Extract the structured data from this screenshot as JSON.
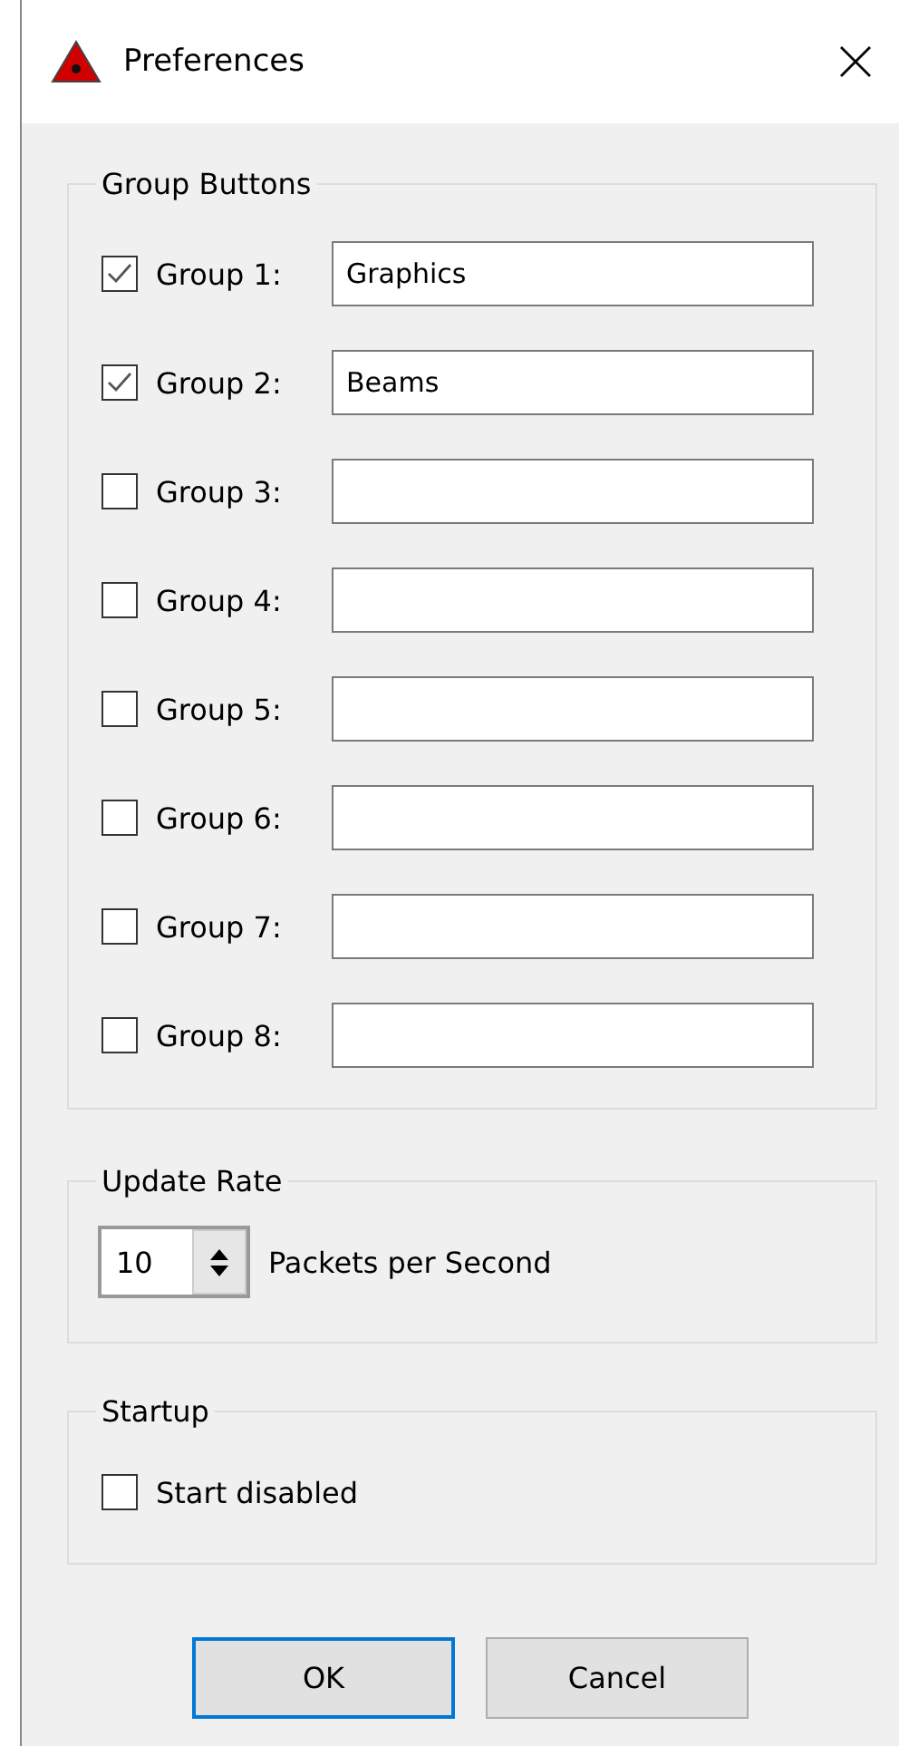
{
  "window": {
    "title": "Preferences"
  },
  "group_buttons": {
    "title": "Group Buttons",
    "groups": [
      {
        "label": "Group 1:",
        "checked": true,
        "value": "Graphics"
      },
      {
        "label": "Group 2:",
        "checked": true,
        "value": "Beams"
      },
      {
        "label": "Group 3:",
        "checked": false
      },
      {
        "label": "Group 4:",
        "checked": false
      },
      {
        "label": "Group 5:",
        "checked": false
      },
      {
        "label": "Group 6:",
        "checked": false
      },
      {
        "label": "Group 7:",
        "checked": false
      },
      {
        "label": "Group 8:",
        "checked": false
      }
    ]
  },
  "update_rate": {
    "title": "Update Rate",
    "value": "10",
    "unit": "Packets per Second"
  },
  "startup": {
    "title": "Startup",
    "option": {
      "label": "Start disabled",
      "checked": false
    }
  },
  "buttons": [
    {
      "label": "OK",
      "default": true
    },
    {
      "label": "Cancel",
      "default": false
    }
  ]
}
